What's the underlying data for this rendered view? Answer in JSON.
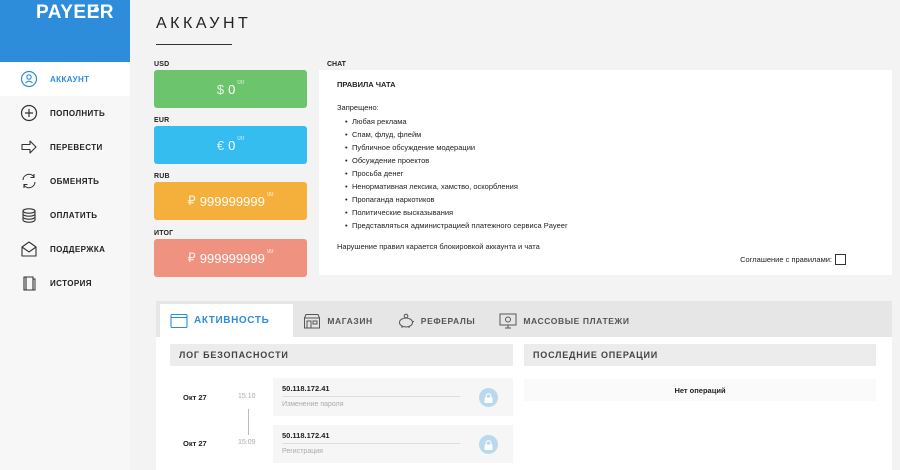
{
  "app": {
    "logo": "PAYEER"
  },
  "sidebar": {
    "items": [
      {
        "label": "АККАУНТ",
        "icon": "account-icon",
        "active": true
      },
      {
        "label": "ПОПОЛНИТЬ",
        "icon": "plus-circle-icon",
        "active": false
      },
      {
        "label": "ПЕРЕВЕСТИ",
        "icon": "arrow-right-icon",
        "active": false
      },
      {
        "label": "ОБМЕНЯТЬ",
        "icon": "exchange-icon",
        "active": false
      },
      {
        "label": "ОПЛАТИТЬ",
        "icon": "coins-icon",
        "active": false
      },
      {
        "label": "ПОДДЕРЖКА",
        "icon": "envelope-icon",
        "active": false
      },
      {
        "label": "ИСТОРИЯ",
        "icon": "book-icon",
        "active": false
      }
    ]
  },
  "header": {
    "title": "АККАУНТ"
  },
  "balances": [
    {
      "label": "USD",
      "symbol": "$",
      "amount": "0",
      "cents": "00",
      "color": "#6cc56d"
    },
    {
      "label": "EUR",
      "symbol": "€",
      "amount": "0",
      "cents": "00",
      "color": "#35bdf0"
    },
    {
      "label": "RUB",
      "symbol": "₽",
      "amount": "999999999",
      "cents": "99",
      "color": "#f5b03c"
    },
    {
      "label": "ИТОГ",
      "symbol": "₽",
      "amount": "999999999",
      "cents": "99",
      "color": "#ef9280"
    }
  ],
  "chat": {
    "label": "CHAT",
    "title": "ПРАВИЛА ЧАТА",
    "forbidden": "Запрещено:",
    "rules": [
      "Любая реклама",
      "Спам, флуд, флейм",
      "Публичное обсуждение модерации",
      "Обсуждение проектов",
      "Просьба денег",
      "Ненормативная лексика, хамство, оскорбления",
      "Пропаганда наркотиков",
      "Политические высказывания",
      "Представляться администрацией платежного сервиса Payeer"
    ],
    "violation": "Нарушение правил карается блокировкой аккаунта и чата",
    "agreement": "Соглашение с правилами:"
  },
  "tabs": [
    {
      "label": "АКТИВНОСТЬ",
      "icon": "browser-window-icon",
      "active": true
    },
    {
      "label": "МАГАЗИН",
      "icon": "shop-icon",
      "active": false
    },
    {
      "label": "РЕФЕРАЛЫ",
      "icon": "piggy-bank-icon",
      "active": false
    },
    {
      "label": "МАССОВЫЕ ПЛАТЕЖИ",
      "icon": "monitor-icon",
      "active": false
    }
  ],
  "security_log": {
    "title": "ЛОГ БЕЗОПАСНОСТИ",
    "entries": [
      {
        "date": "Окт 27",
        "time": "15:10",
        "ip": "50.118.172.41",
        "action": "Изменение пароля"
      },
      {
        "date": "Окт 27",
        "time": "15:09",
        "ip": "50.118.172.41",
        "action": "Регистрация"
      }
    ]
  },
  "recent_ops": {
    "title": "ПОСЛЕДНИЕ ОПЕРАЦИИ",
    "empty": "Нет операций"
  }
}
